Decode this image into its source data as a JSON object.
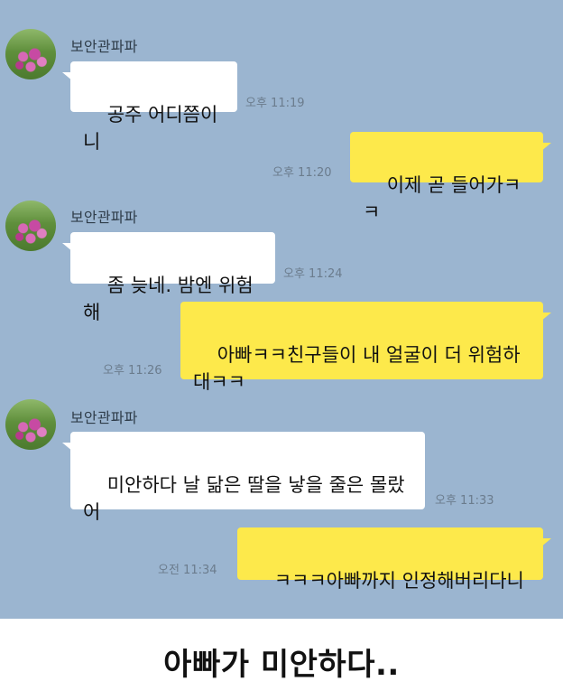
{
  "sender_name": "보안관파파",
  "messages": [
    {
      "from": "other",
      "text": "공주 어디쯤이니",
      "time": "오후 11:19"
    },
    {
      "from": "me",
      "text": "이제 곧 들어가ㅋㅋ",
      "time": "오후 11:20"
    },
    {
      "from": "other",
      "text": "좀 늦네. 밤엔 위험해",
      "time": "오후 11:24"
    },
    {
      "from": "me",
      "text": "아빠ㅋㅋ친구들이 내 얼굴이 더 위험하\n대ㅋㅋ",
      "time": "오후 11:26"
    },
    {
      "from": "other",
      "text": "미안하다 날 닮은 딸을 낳을 줄은 몰랐\n어",
      "time": "오후 11:33"
    },
    {
      "from": "me",
      "text": "ㅋㅋㅋ아빠까지 인정해버리다니",
      "time": "오전 11:34"
    }
  ],
  "caption": "아빠가 미안하다..",
  "colors": {
    "chat_background": "#9bb5d0",
    "my_bubble": "#fde94b",
    "other_bubble": "#ffffff"
  }
}
